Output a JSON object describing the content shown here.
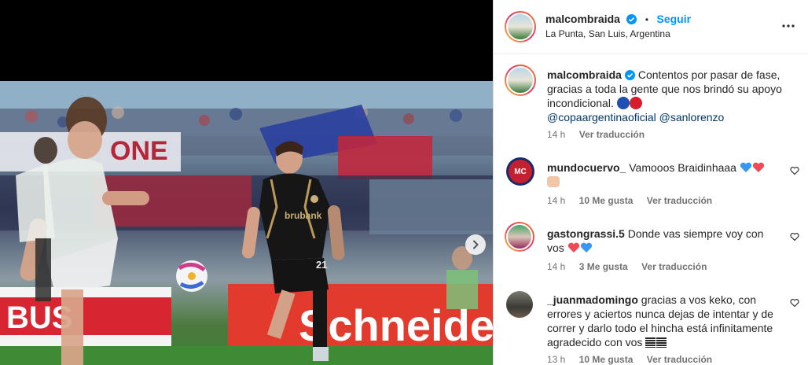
{
  "header": {
    "username": "malcombraida",
    "separator": "•",
    "follow_label": "Seguir",
    "location": "La Punta, San Luis, Argentina"
  },
  "caption": {
    "username": "malcombraida",
    "text": "Contentos por pasar de fase, gracias a toda la gente que nos brindó su apoyo incondicional.",
    "mention1": "@copaargentinaoficial",
    "mention2": "@sanlorenzo",
    "time": "14 h",
    "see_translation": "Ver traducción"
  },
  "comments": [
    {
      "username": "mundocuervo_",
      "text": "Vamooos Braidinhaaa",
      "time": "14 h",
      "likes": "10 Me gusta",
      "see_translation": "Ver traducción",
      "avatar_text": "MC"
    },
    {
      "username": "gastongrassi.5",
      "text": "Donde vas siempre voy con vos",
      "time": "14 h",
      "likes": "3 Me gusta",
      "see_translation": "Ver traducción"
    },
    {
      "username": "_juanmadomingo",
      "text": "gracias a vos keko, con errores y aciertos nunca dejas de intentar y de correr y darlo todo el hincha está infinitamente agradecido con vos",
      "time": "13 h",
      "likes": "10 Me gusta",
      "see_translation": "Ver traducción"
    }
  ],
  "photo": {
    "sponsor_text": "brubank",
    "ad_left": "BUS",
    "ad_right": "Schneide",
    "banner_text": "ONE",
    "shirt_number": "21"
  },
  "colors": {
    "follow": "#0095f6",
    "verified": "#0095f6",
    "heart_red": "#ed4956",
    "heart_blue": "#3897f0"
  }
}
